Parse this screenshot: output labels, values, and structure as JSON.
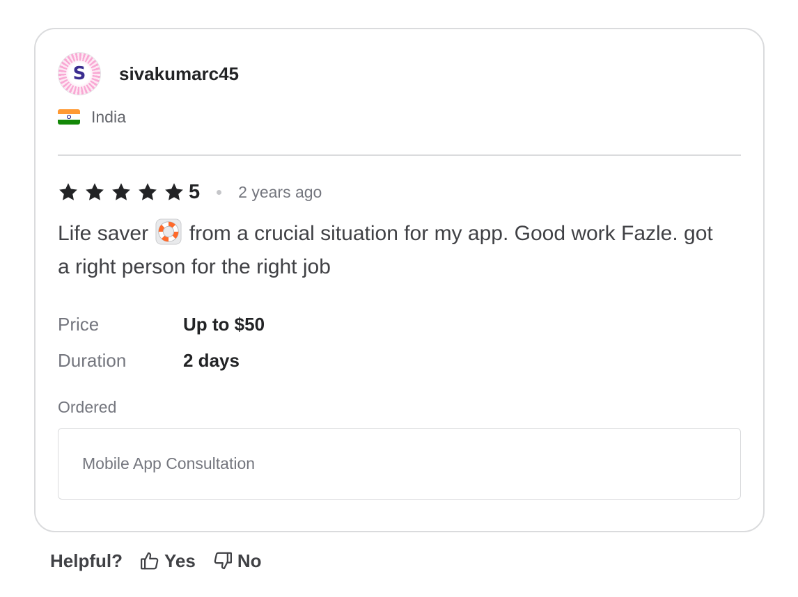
{
  "review": {
    "user": {
      "avatar_letter": "S",
      "username": "sivakumarc45",
      "country": "India",
      "flag_icon": "india-flag-icon"
    },
    "rating": {
      "stars": 5,
      "value": "5",
      "time_ago": "2 years ago"
    },
    "text_part1": "Life saver",
    "emoji_icon": "lifebuoy-icon",
    "text_part2": "from a crucial situation for my app. Good work Fazle. got a right person for the right job",
    "details": [
      {
        "label": "Price",
        "value": "Up to $50"
      },
      {
        "label": "Duration",
        "value": "2 days"
      }
    ],
    "ordered": {
      "label": "Ordered",
      "item": "Mobile App Consultation"
    }
  },
  "helpful": {
    "label": "Helpful?",
    "yes_label": "Yes",
    "no_label": "No",
    "yes_icon": "thumbs-up-icon",
    "no_icon": "thumbs-down-icon"
  },
  "colors": {
    "text_primary": "#222325",
    "text_secondary": "#74767e",
    "border": "#dadbdd",
    "star": "#222325"
  }
}
